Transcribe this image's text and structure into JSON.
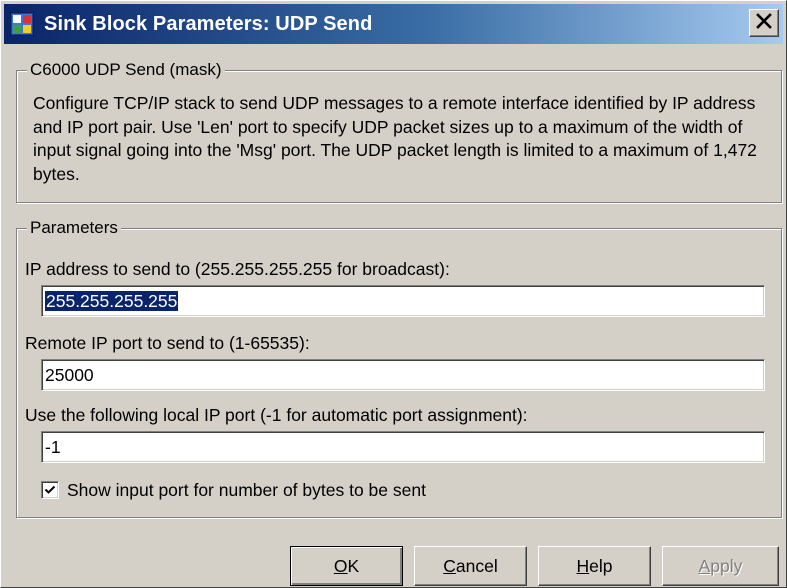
{
  "window": {
    "title": "Sink Block Parameters: UDP Send",
    "icon": "simulink-block-icon",
    "close_glyph": "✕"
  },
  "mask_group": {
    "legend": "C6000 UDP Send (mask)",
    "description": "Configure  TCP/IP stack to send UDP messages to a remote interface identified by  IP address and IP port pair. Use 'Len' port to specify UDP packet sizes up to a maximum of the width of input signal going into the 'Msg' port. The UDP packet length is limited to a maximum of 1,472 bytes."
  },
  "parameters_group": {
    "legend": "Parameters",
    "ip_address": {
      "label": "IP address to send to (255.255.255.255 for broadcast):",
      "value": "255.255.255.255",
      "selected": true
    },
    "remote_port": {
      "label": "Remote IP port to send to (1-65535):",
      "value": "25000"
    },
    "local_port": {
      "label": "Use the following local IP port (-1 for automatic port assignment):",
      "value": "-1"
    },
    "show_bytes_port": {
      "label": "Show input port for number of bytes to be sent",
      "checked": true
    }
  },
  "buttons": {
    "ok": {
      "mnemonic": "O",
      "rest": "K"
    },
    "cancel": {
      "mnemonic": "C",
      "rest": "ancel"
    },
    "help": {
      "mnemonic": "H",
      "rest": "elp"
    },
    "apply": {
      "mnemonic": "A",
      "rest": "pply",
      "disabled": true
    }
  },
  "colors": {
    "title_gradient_start": "#0a246a",
    "title_gradient_end": "#a6caf0",
    "dialog_face": "#d4d0c8",
    "selection": "#0a246a"
  }
}
